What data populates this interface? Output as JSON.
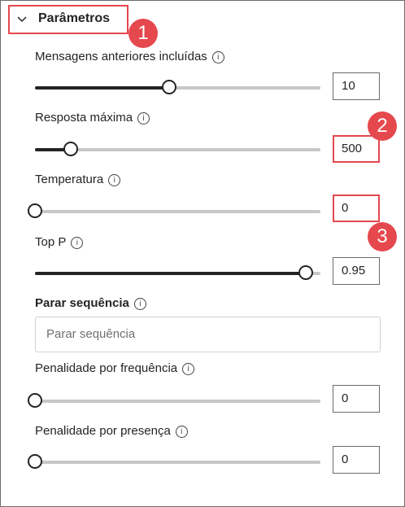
{
  "section": {
    "title": "Parâmetros",
    "expanded": true,
    "chevron_icon": "chevron-down-icon"
  },
  "callouts": [
    "1",
    "2",
    "3"
  ],
  "info_icon_glyph": "i",
  "params": {
    "past_messages": {
      "label": "Mensagens anteriores incluídas",
      "value": "10",
      "fraction": 0.47
    },
    "max_response": {
      "label": "Resposta máxima",
      "value": "500",
      "fraction": 0.125
    },
    "temperature": {
      "label": "Temperatura",
      "value": "0",
      "fraction": 0.0
    },
    "top_p": {
      "label": "Top P",
      "value": "0.95",
      "fraction": 0.95
    },
    "stop_sequence": {
      "label": "Parar sequência",
      "placeholder": "Parar sequência"
    },
    "frequency_penalty": {
      "label": "Penalidade por frequência",
      "value": "0",
      "fraction": 0.0
    },
    "presence_penalty": {
      "label": "Penalidade por presença",
      "value": "0",
      "fraction": 0.0
    }
  },
  "colors": {
    "highlight": "#e5484d",
    "track": "#c7c7c7",
    "fill": "#242424"
  }
}
